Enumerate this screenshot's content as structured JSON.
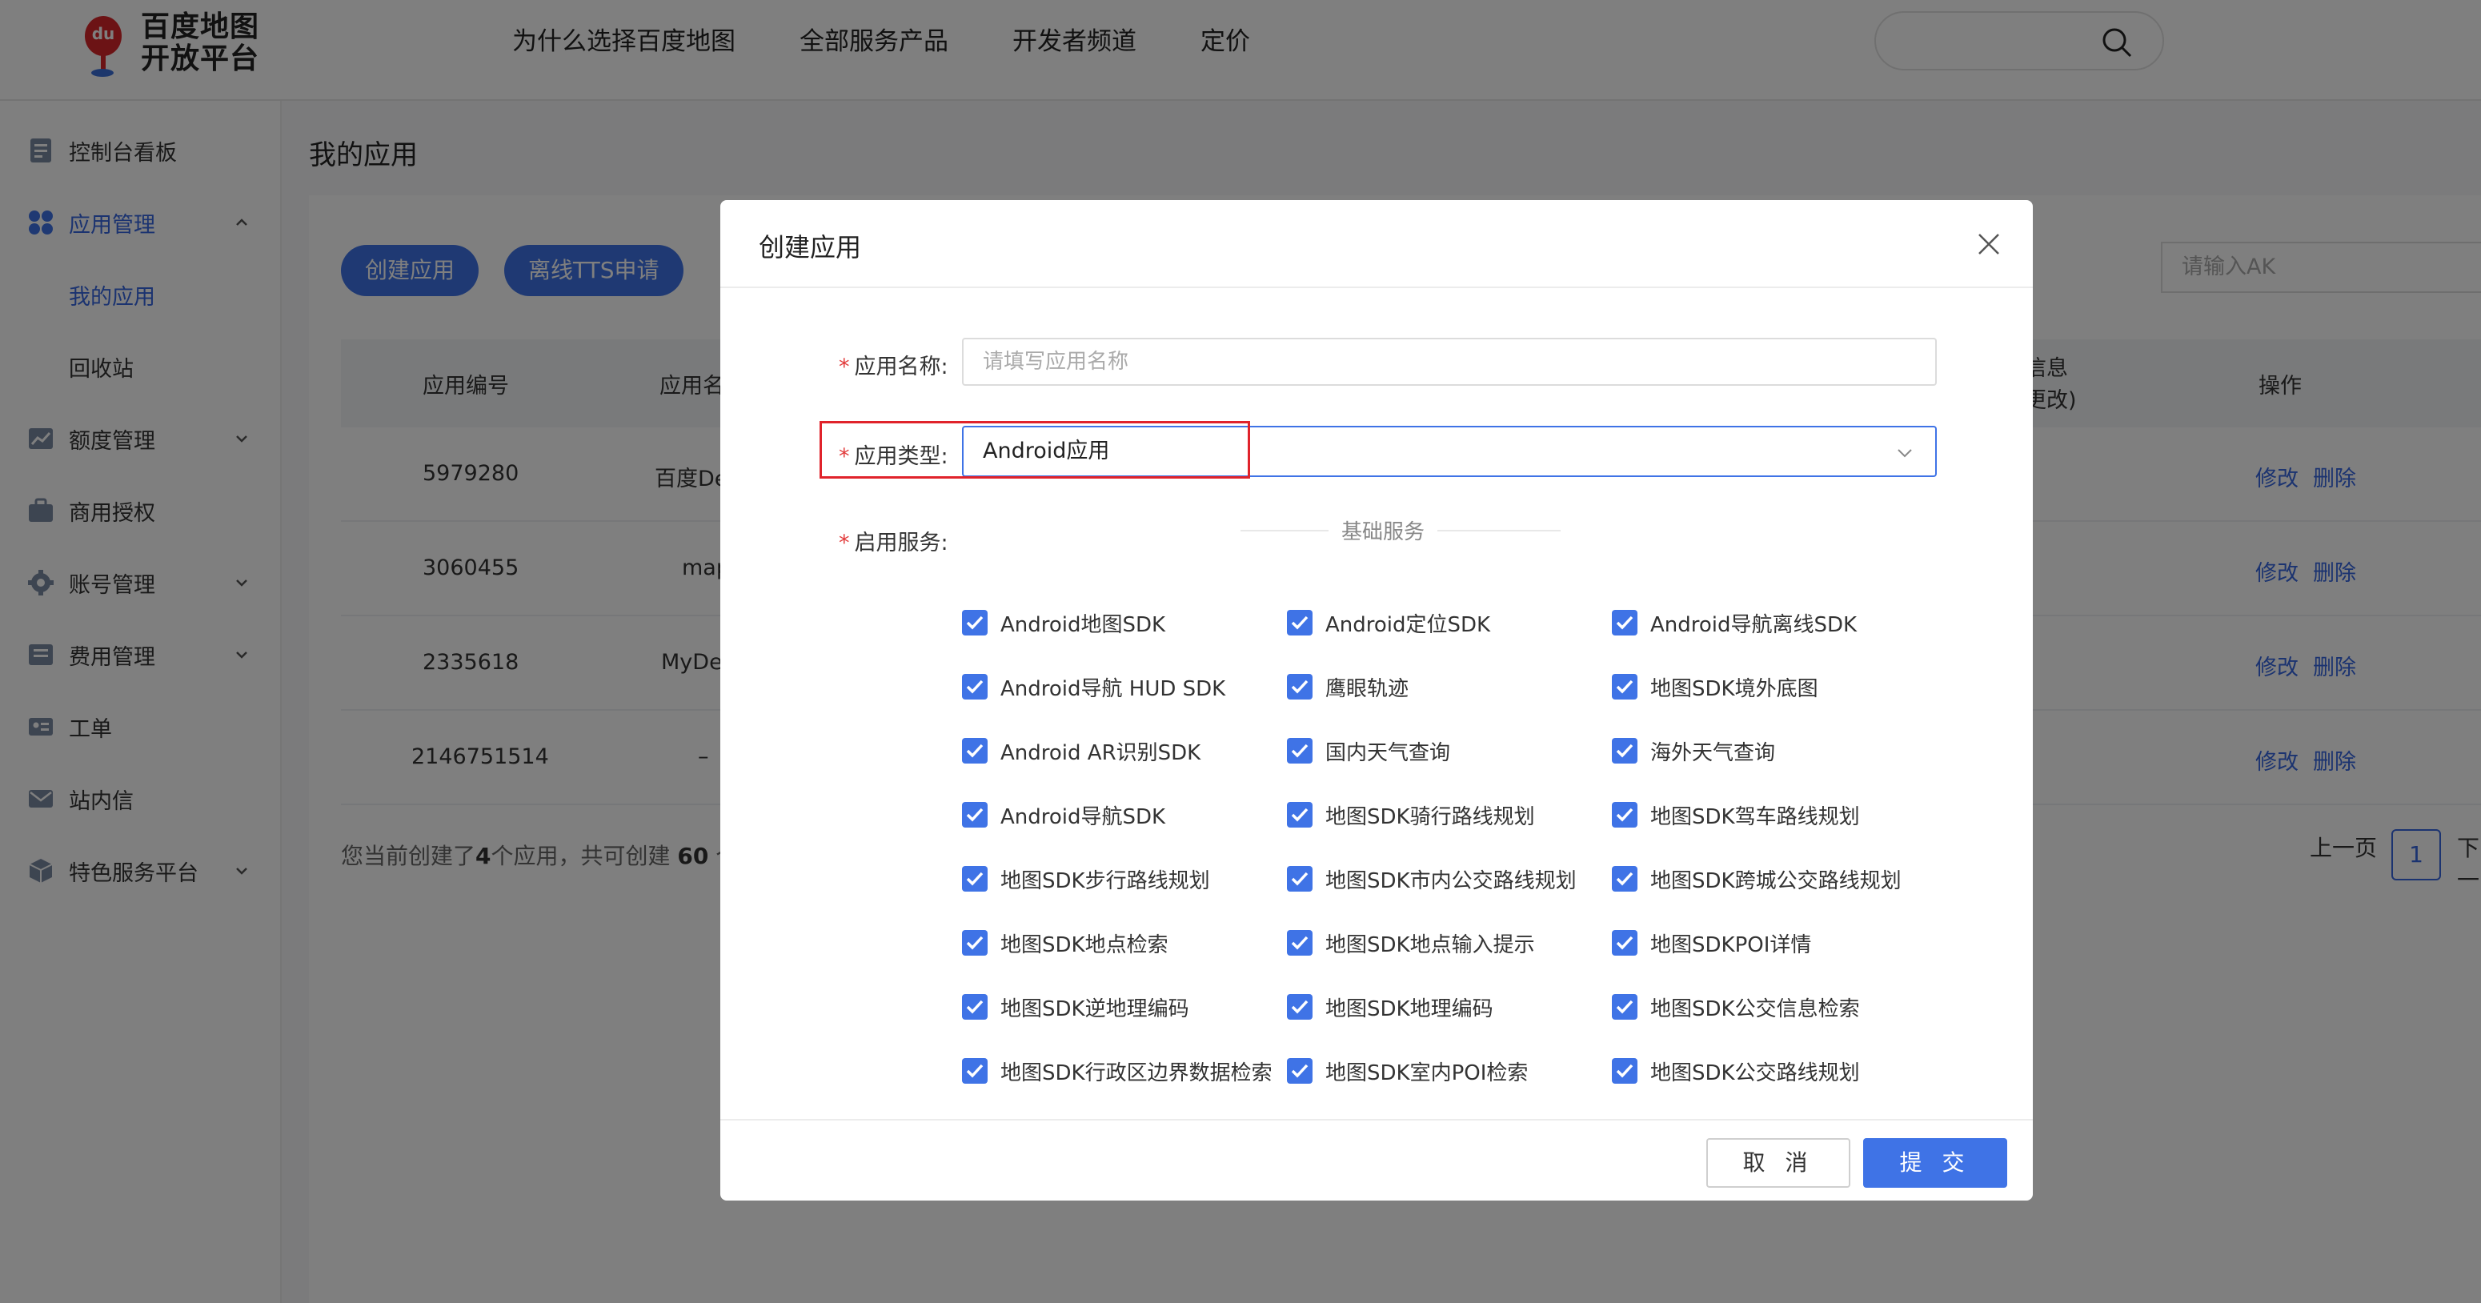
{
  "header": {
    "logo_line1": "百度地图",
    "logo_line2": "开放平台",
    "logo_badge": "du",
    "nav": [
      "为什么选择百度地图",
      "全部服务产品",
      "开发者频道",
      "定价"
    ]
  },
  "sidebar": {
    "items": [
      {
        "label": "控制台看板",
        "icon": "dashboard-icon"
      },
      {
        "label": "应用管理",
        "icon": "apps-icon",
        "expanded": true
      },
      {
        "label": "我的应用",
        "sub": true,
        "active": true
      },
      {
        "label": "回收站",
        "sub": true
      },
      {
        "label": "额度管理",
        "icon": "quota-icon",
        "chevron": true
      },
      {
        "label": "商用授权",
        "icon": "briefcase-icon"
      },
      {
        "label": "账号管理",
        "icon": "gear-icon",
        "chevron": true
      },
      {
        "label": "费用管理",
        "icon": "billing-icon",
        "chevron": true
      },
      {
        "label": "工单",
        "icon": "ticket-icon"
      },
      {
        "label": "站内信",
        "icon": "mail-icon"
      },
      {
        "label": "特色服务平台",
        "icon": "cube-icon",
        "chevron": true
      }
    ]
  },
  "main": {
    "page_title": "我的应用",
    "create_btn": "创建应用",
    "tts_btn": "离线TTS申请",
    "ak_placeholder": "请输入AK",
    "table": {
      "headers": [
        "应用编号",
        "应用名",
        "信息",
        "更改)",
        "操作"
      ],
      "rows": [
        {
          "id": "5979280",
          "name": "百度De",
          "edit": "修改",
          "del": "删除"
        },
        {
          "id": "3060455",
          "name": "map",
          "edit": "修改",
          "del": "删除"
        },
        {
          "id": "2335618",
          "name": "MyDer",
          "edit": "修改",
          "del": "删除"
        },
        {
          "id": "2146751514",
          "name": "–",
          "edit": "修改",
          "del": "删除"
        }
      ]
    },
    "footer_prefix": "您当前创建了",
    "footer_count": "4",
    "footer_mid": "个应用，共可创建",
    "footer_limit": "60",
    "footer_suffix": "个",
    "pager_prev": "上一页",
    "pager_page": "1",
    "pager_next": "下一"
  },
  "modal": {
    "title": "创建应用",
    "name_label": "应用名称:",
    "name_placeholder": "请填写应用名称",
    "type_label": "应用类型:",
    "type_value": "Android应用",
    "service_label": "启用服务:",
    "section_label": "基础服务",
    "services": [
      "Android地图SDK",
      "Android定位SDK",
      "Android导航离线SDK",
      "Android导航 HUD SDK",
      "鹰眼轨迹",
      "地图SDK境外底图",
      "Android AR识别SDK",
      "国内天气查询",
      "海外天气查询",
      "Android导航SDK",
      "地图SDK骑行路线规划",
      "地图SDK驾车路线规划",
      "地图SDK步行路线规划",
      "地图SDK市内公交路线规划",
      "地图SDK跨城公交路线规划",
      "地图SDK地点检索",
      "地图SDK地点输入提示",
      "地图SDKPOI详情",
      "地图SDK逆地理编码",
      "地图SDK地理编码",
      "地图SDK公交信息检索",
      "地图SDK行政区边界数据检索",
      "地图SDK室内POI检索",
      "地图SDK公交路线规划"
    ],
    "cancel": "取 消",
    "submit": "提 交"
  },
  "colors": {
    "accent": "#3f73e6",
    "highlight": "#e0232b",
    "required": "#e23b3b"
  }
}
